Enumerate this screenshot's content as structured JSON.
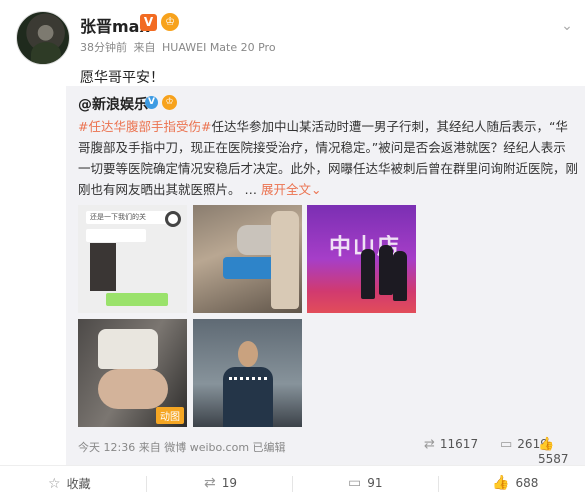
{
  "post": {
    "author": "张晋max",
    "v_badge": "V",
    "level_badge": "♔",
    "time": "38分钟前",
    "source_prefix": "来自",
    "source": "HUAWEI Mate 20 Pro",
    "text": "愿华哥平安！"
  },
  "repost": {
    "author": "@新浪娱乐",
    "v_badge": "V",
    "level_badge": "♔",
    "hashtag": "#任达华腹部手指受伤#",
    "body": "任达华参加中山某活动时遭一男子行刺，其经纪人随后表示，“华哥腹部及手指中刀，现正在医院接受治疗，情况稳定。”被问是否会返港就医？经纪人表示一切要等医院确定情况安稳后才决定。此外，网曝任达华被刺后曾在群里问询附近医院，刚刚也有网友晒出其就医照片。",
    "ellipsis": "…",
    "expand_label": "展开全文",
    "expand_arrow": "⌄",
    "images": {
      "chat_text": "还是一下我们的关",
      "stage_text": "中山店",
      "gif_label": "动图"
    },
    "footer": {
      "time": "今天 12:36",
      "source_prefix": "来自",
      "source": "微博 weibo.com",
      "edited": "已编辑",
      "reposts": "11617",
      "comments": "2619",
      "likes": "5587"
    }
  },
  "actions": {
    "favorite": "收藏",
    "repost_count": "19",
    "comment_count": "91",
    "like_count": "688"
  },
  "icons": {
    "chevron": "chevron-down-icon",
    "repost": "repost-icon",
    "comment": "comment-icon",
    "like": "like-icon",
    "favorite": "star-icon"
  },
  "colors": {
    "accent": "#eb7350",
    "repost_bg": "#f2f2f5"
  }
}
